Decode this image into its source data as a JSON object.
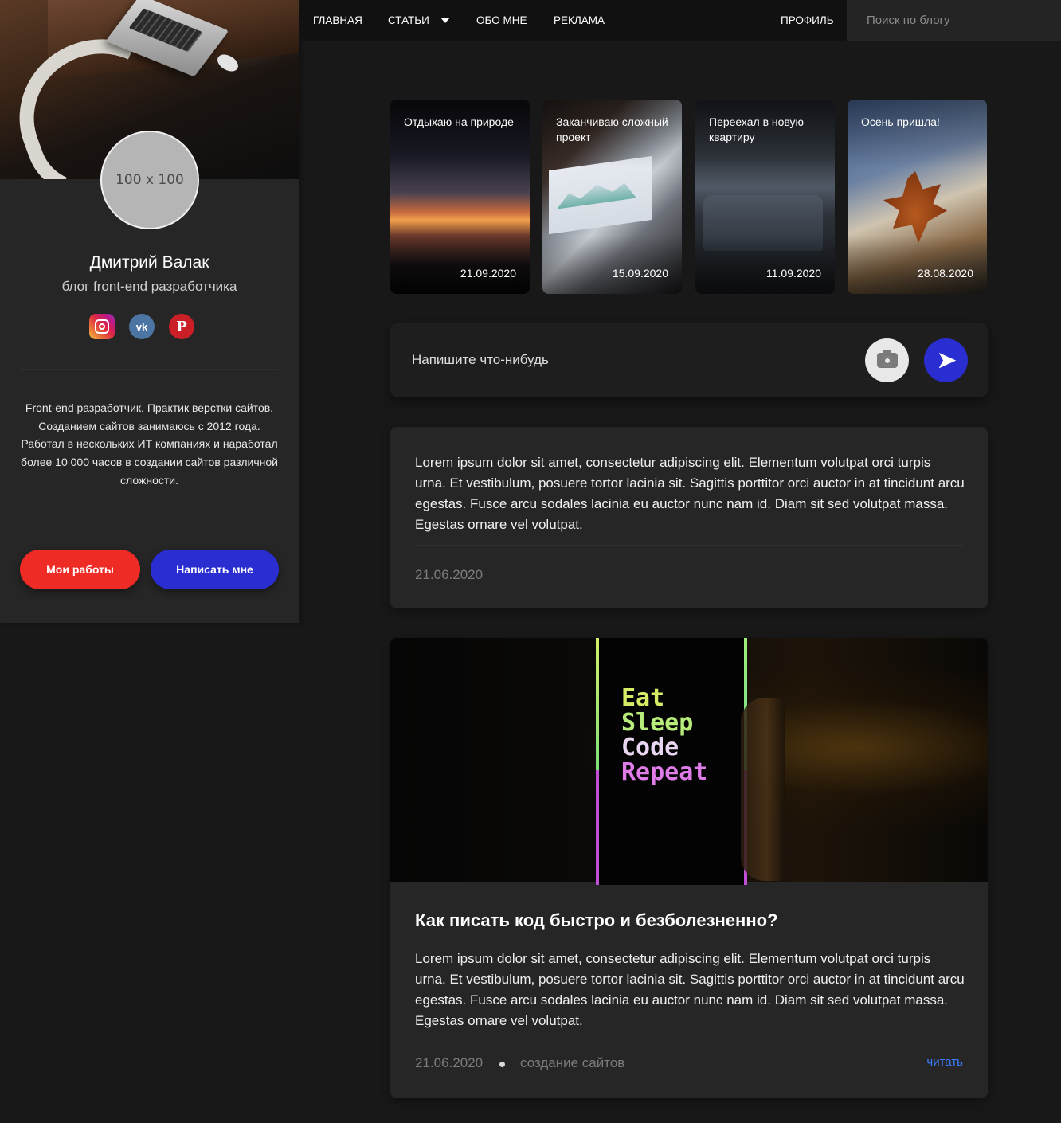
{
  "nav": {
    "items": [
      {
        "label": "ГЛАВНАЯ"
      },
      {
        "label": "СТАТЬИ"
      },
      {
        "label": "ОБО МНЕ"
      },
      {
        "label": "РЕКЛАМА"
      }
    ],
    "profile_label": "ПРОФИЛЬ",
    "search_placeholder": "Поиск по блогу"
  },
  "sidebar": {
    "avatar_text": "100 x 100",
    "name": "Дмитрий Валак",
    "subtitle": "блог front-end разработчика",
    "socials": [
      {
        "icon": "instagram-icon"
      },
      {
        "icon": "vk-icon",
        "glyph": "vk"
      },
      {
        "icon": "pinterest-icon",
        "glyph": "P"
      }
    ],
    "about": "Front-end разработчик. Практик верстки сайтов. Созданием сайтов занимаюсь с 2012 года. Работал в нескольких ИТ компаниях и наработал более 10 000 часов в создании сайтов различной сложности.",
    "buttons": {
      "works": "Мои работы",
      "write": "Написать мне"
    }
  },
  "stories": [
    {
      "title": "Отдыхаю на природе",
      "date": "21.09.2020"
    },
    {
      "title": "Заканчиваю сложный проект",
      "date": "15.09.2020"
    },
    {
      "title": "Переехал в новую квартиру",
      "date": "11.09.2020"
    },
    {
      "title": "Осень пришла!",
      "date": "28.08.2020"
    }
  ],
  "composer": {
    "placeholder": "Напишите что-нибудь"
  },
  "posts": [
    {
      "text": "Lorem ipsum dolor sit amet, consectetur adipiscing elit. Elementum volutpat orci turpis urna. Et vestibulum, posuere tortor lacinia sit. Sagittis porttitor orci auctor in at tincidunt arcu egestas. Fusce arcu sodales lacinia eu auctor nunc nam id. Diam sit sed volutpat massa. Egestas ornare vel volutpat.",
      "date": "21.06.2020"
    },
    {
      "image_text": [
        "Eat",
        "Sleep",
        "Code",
        "Repeat"
      ],
      "title": "Как писать код быстро и безболезненно?",
      "text": "Lorem ipsum dolor sit amet, consectetur adipiscing elit. Elementum volutpat orci turpis urna. Et vestibulum, posuere tortor lacinia sit. Sagittis porttitor orci auctor in at tincidunt arcu egestas. Fusce arcu sodales lacinia eu auctor nunc nam id. Diam sit sed volutpat massa. Egestas ornare vel volutpat.",
      "date": "21.06.2020",
      "tag": "создание сайтов",
      "read_label": "читать"
    }
  ],
  "colors": {
    "background": "#181818",
    "sidebar": "#262626",
    "accent_red": "#ee2b24",
    "accent_blue": "#2a2ed0",
    "link": "#3b7bff"
  }
}
